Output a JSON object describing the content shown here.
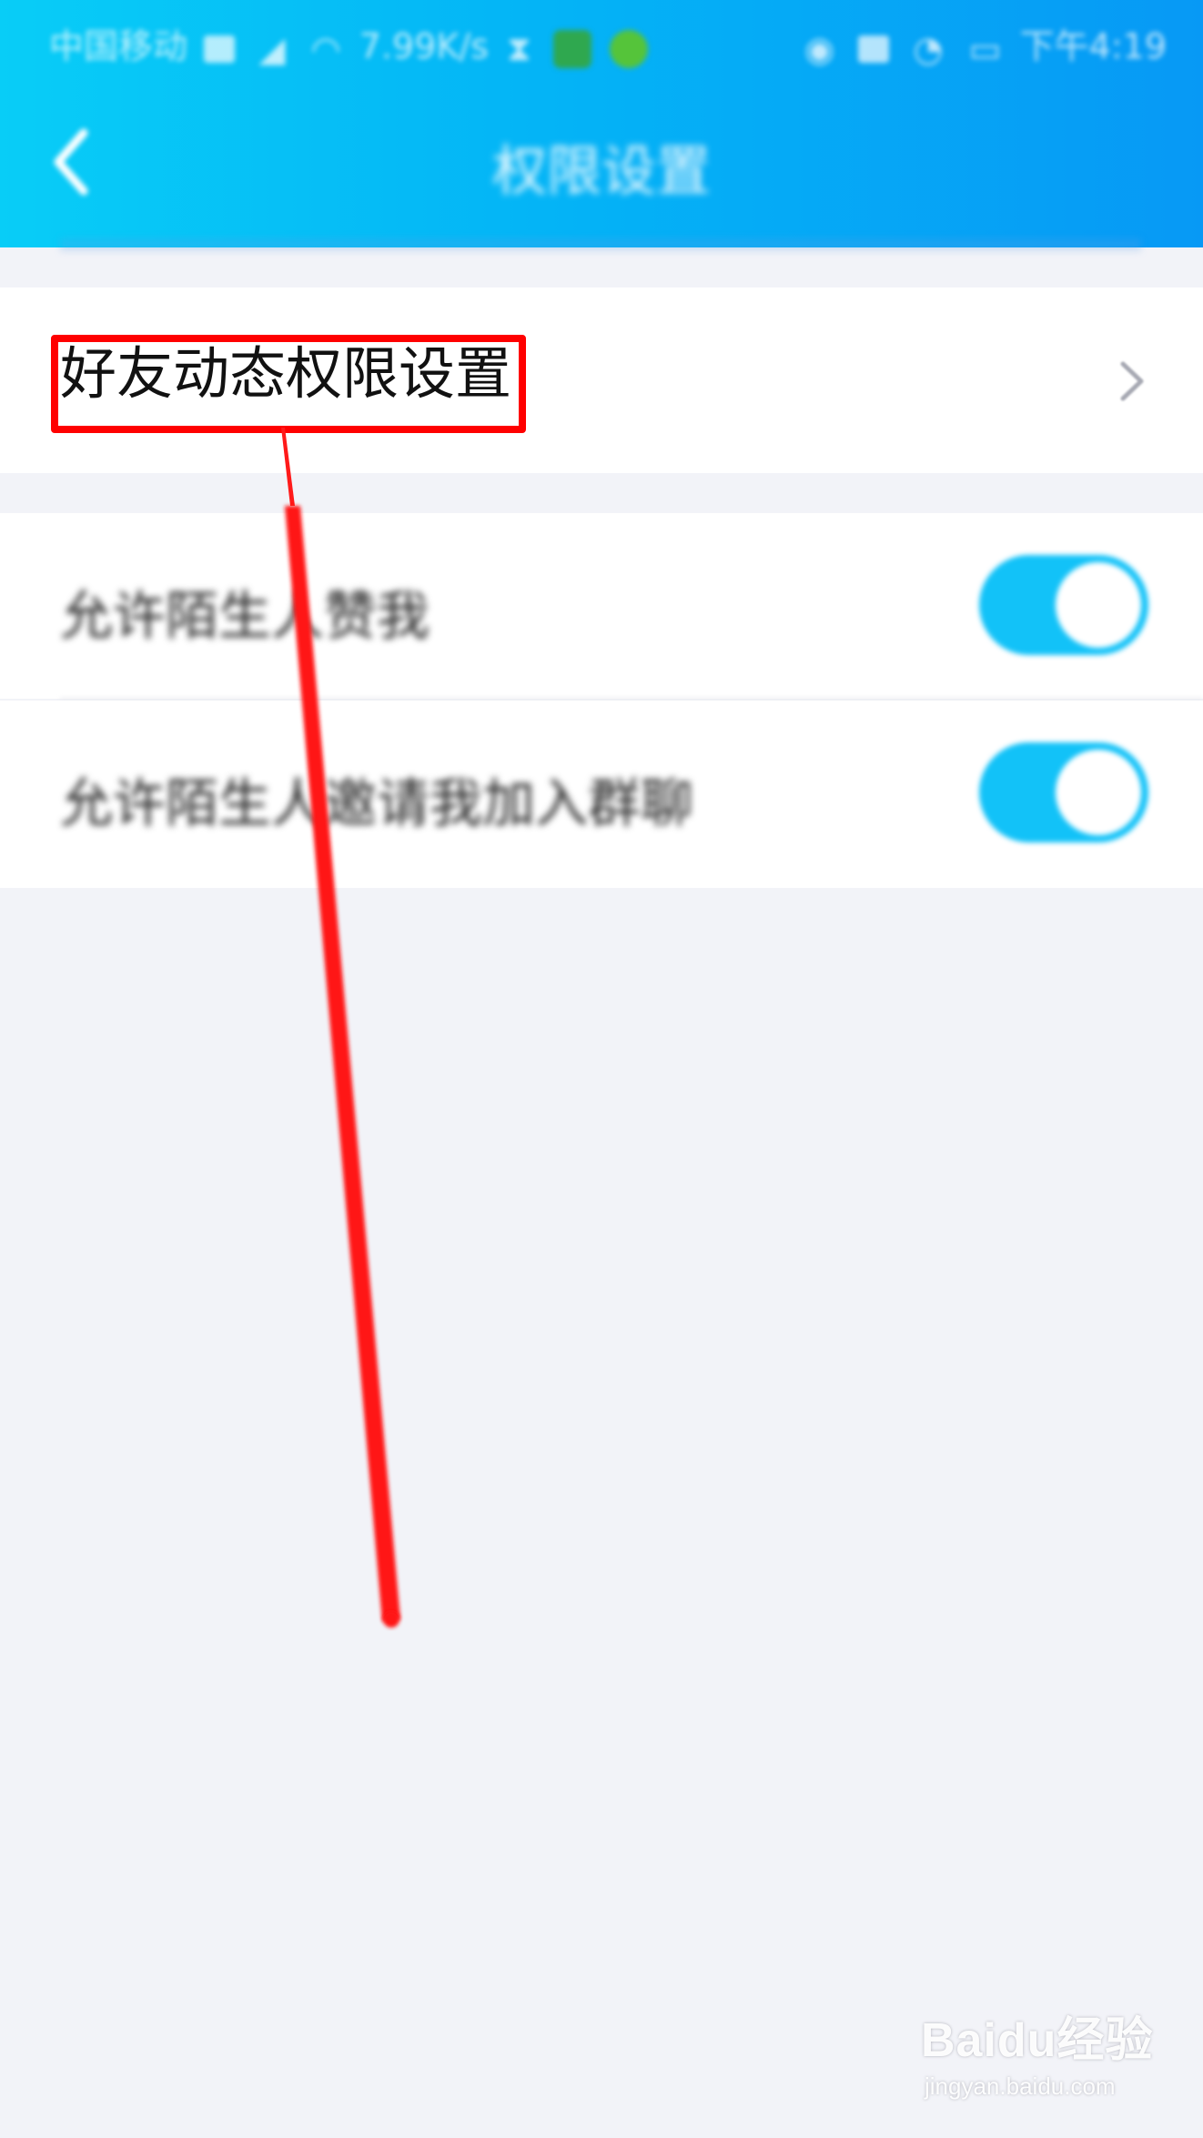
{
  "status_bar": {
    "carrier": "中国移动",
    "net_speed": "7.99K/s",
    "time": "下午4:19"
  },
  "nav": {
    "back_icon": "chevron-left-icon",
    "title": "权限设置"
  },
  "settings": {
    "friend_feed_permissions": {
      "label": "好友动态权限设置",
      "icon": "chevron-right-icon"
    },
    "allow_stranger_like": {
      "label": "允许陌生人赞我",
      "enabled": true
    },
    "allow_stranger_group_invite": {
      "label": "允许陌生人邀请我加入群聊",
      "enabled": true
    }
  },
  "watermark": {
    "logo": "Baidu经验",
    "url": "jingyan.baidu.com"
  },
  "colors": {
    "header_start": "#08cdf7",
    "header_end": "#0799f5",
    "toggle_on": "#12c2f8",
    "annotation": "#ff0000",
    "page_bg": "#f2f3f8"
  }
}
